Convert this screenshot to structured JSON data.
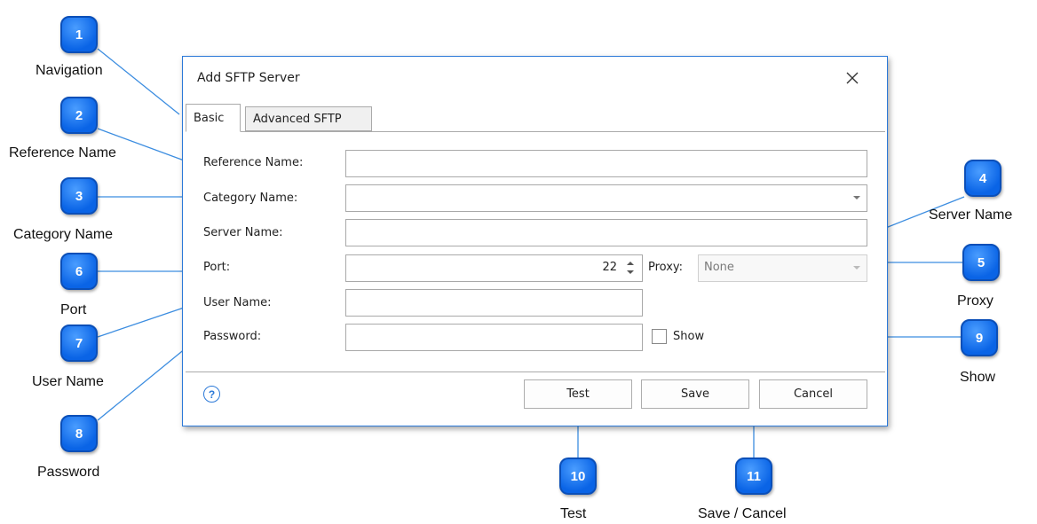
{
  "dialog": {
    "title": "Add SFTP Server",
    "close_icon": "close-icon",
    "tabs": [
      {
        "label": "Basic",
        "active": true
      },
      {
        "label": "Advanced SFTP",
        "active": false
      }
    ],
    "fields": {
      "reference_name": {
        "label": "Reference Name:",
        "value": ""
      },
      "category_name": {
        "label": "Category Name:",
        "value": ""
      },
      "server_name": {
        "label": "Server Name:",
        "value": ""
      },
      "port": {
        "label": "Port:",
        "value": "22"
      },
      "proxy": {
        "label": "Proxy:",
        "value": "None"
      },
      "user_name": {
        "label": "User Name:",
        "value": ""
      },
      "password": {
        "label": "Password:",
        "value": ""
      },
      "show": {
        "label": "Show",
        "checked": false
      }
    },
    "buttons": {
      "test": "Test",
      "save": "Save",
      "cancel": "Cancel"
    },
    "help_icon": "help-icon",
    "help_glyph": "?"
  },
  "callouts": [
    {
      "number": "1",
      "label": "Navigation"
    },
    {
      "number": "2",
      "label": "Reference Name"
    },
    {
      "number": "3",
      "label": "Category Name"
    },
    {
      "number": "4",
      "label": "Server Name"
    },
    {
      "number": "5",
      "label": "Proxy"
    },
    {
      "number": "6",
      "label": "Port"
    },
    {
      "number": "7",
      "label": "User Name"
    },
    {
      "number": "8",
      "label": "Password"
    },
    {
      "number": "9",
      "label": "Show"
    },
    {
      "number": "10",
      "label": "Test"
    },
    {
      "number": "11",
      "label": "Save / Cancel"
    }
  ],
  "colors": {
    "accent": "#2b79d8",
    "badge": "#0a64e6",
    "callout_line": "#3c8de0"
  }
}
